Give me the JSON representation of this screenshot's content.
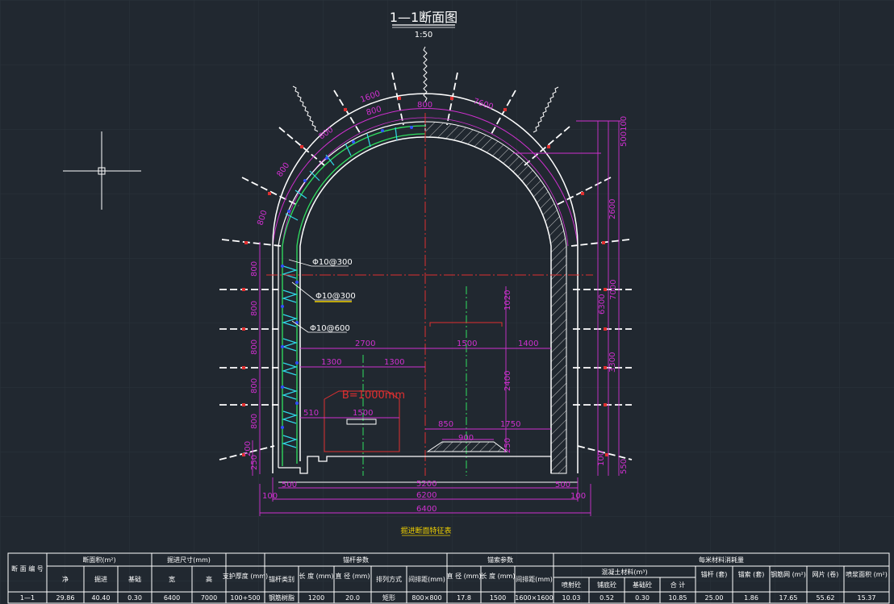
{
  "drawing": {
    "title": "1—1断面图",
    "scale": "1:50",
    "table_caption": "掘进断面特征表",
    "dims": {
      "arc_1600": "1600",
      "arc_7600": "7600",
      "arc_800_top": "800",
      "arc_800_left": "800",
      "arc_800_b": "800",
      "arc_800_c": "800",
      "left_800_1": "800",
      "left_800_2": "800",
      "left_800_3": "800",
      "left_800_4": "800",
      "left_800_5": "800",
      "left_800_6": "800",
      "left_250": "250",
      "left_200": "200",
      "right_500_100": "500100",
      "right_2600": "2600",
      "right_6300": "6300",
      "right_7000": "7000",
      "right_3300": "3300",
      "right_100": "100",
      "right_550": "550",
      "d_1020": "1020",
      "d_2400": "2400",
      "d_250": "250",
      "d_2700": "2700",
      "d_1500": "1500",
      "d_1400": "1400",
      "d_1300a": "1300",
      "d_1300b": "1300",
      "d_510": "510",
      "d_1500b": "1500",
      "d_850": "850",
      "d_1750": "1750",
      "d_900": "900",
      "b_500l": "500",
      "b_500r": "500",
      "b_100l": "100",
      "b_100r": "100",
      "b_5200": "5200",
      "b_6200": "6200",
      "b_6400": "6400"
    },
    "bolt_labels": [
      "Φ10@300",
      "Φ10@300",
      "Φ10@600"
    ],
    "belt_label": "B=1000mm"
  },
  "table": {
    "header_row1": {
      "section_no": "断 面\n编 号",
      "area_group": "断面积(m²)",
      "size_group": "掘进尺寸(mm)",
      "support_thick": "支护厚度\n(mm)",
      "bolt_group": "锚杆参数",
      "cable_group": "锚索参数",
      "material_group": "每米材料消耗量"
    },
    "header_row2": [
      "净",
      "掘进",
      "基础",
      "宽",
      "高",
      "锚杆类别",
      "长 度\n(mm)",
      "直 径\n(mm)",
      "排列方式",
      "间排距(mm)",
      "直 径\n(mm)",
      "长 度\n(mm)",
      "间排距(mm)",
      "混凝土材料(m³)",
      "锚杆\n(套)",
      "锚索\n(套)",
      "钢筋网\n(m²)",
      "网片\n(卷)",
      "喷浆面积\n(m²)"
    ],
    "concrete_sub": [
      "喷射砼",
      "铺底砼",
      "基础砼",
      "合 计"
    ],
    "row": [
      "1—1",
      "29.86",
      "40.40",
      "0.30",
      "6400",
      "7000",
      "100+500",
      "钢筋树脂",
      "1200",
      "20.0",
      "矩形",
      "800×800",
      "17.8",
      "1500",
      "1600×1600",
      "10.03",
      "0.52",
      "0.30",
      "10.85",
      "25.00",
      "1.86",
      "17.65",
      "55.62",
      "15.37"
    ]
  }
}
